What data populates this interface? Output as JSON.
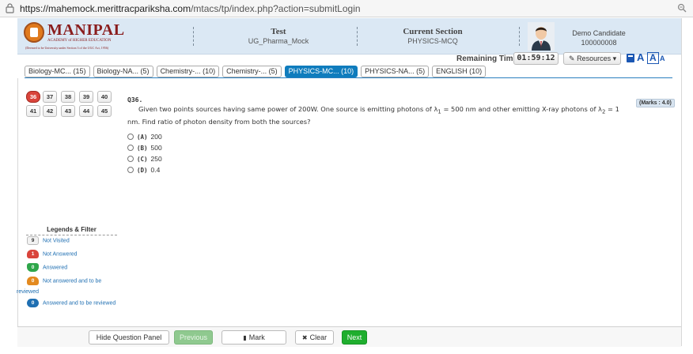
{
  "browser": {
    "url_host": "https://mahemock.merittracpariksha.com",
    "url_path": "/mtacs/tp/index.php?action=submitLogin",
    "lock_icon": "lock-icon",
    "zoom_icon": "zoom-icon"
  },
  "header": {
    "logo_name": "MANIPAL",
    "logo_sub1": "ACADEMY of HIGHER EDUCATION",
    "logo_sub2": "(Deemed to be University under Section 3 of the UGC Act, 1956)",
    "test_label": "Test",
    "test_value": "UG_Pharma_Mock",
    "section_label": "Current Section",
    "section_value": "PHYSICS-MCQ",
    "candidate_name": "Demo Candidate",
    "candidate_id": "100000008"
  },
  "timer": {
    "label": "Remaining Time:",
    "value": "01:59:12"
  },
  "toolbar": {
    "resources_label": "Resources",
    "font_large": "A",
    "font_medium": "A",
    "font_small": "A"
  },
  "tabs": [
    {
      "label": "Biology-MC... (15)",
      "active": false
    },
    {
      "label": "Biology-NA... (5)",
      "active": false
    },
    {
      "label": "Chemistry-... (10)",
      "active": false
    },
    {
      "label": "Chemistry-... (5)",
      "active": false
    },
    {
      "label": "PHYSICS-MC... (10)",
      "active": true
    },
    {
      "label": "PHYSICS-NA... (5)",
      "active": false
    },
    {
      "label": "ENGLISH (10)",
      "active": false
    }
  ],
  "palette": {
    "row1": [
      "36",
      "37",
      "38",
      "39",
      "40"
    ],
    "row2": [
      "41",
      "42",
      "43",
      "44",
      "45"
    ],
    "current": "36"
  },
  "question": {
    "number": "Q36.",
    "marks": "(Marks : 4.0)",
    "text_a": "Given two points sources having same power of 200W. One source is emitting photons of λ",
    "sub1": "1",
    "text_b": " = 500 nm and other emitting X-ray photons of λ",
    "sub2": "2",
    "text_c": " = 1 nm. Find ratio of photon density from both the sources?",
    "options": [
      {
        "label": "(A)",
        "value": "200"
      },
      {
        "label": "(B)",
        "value": "500"
      },
      {
        "label": "(C)",
        "value": "250"
      },
      {
        "label": "(D)",
        "value": "0.4"
      }
    ]
  },
  "legend": {
    "title": "Legends & Filter",
    "items": [
      {
        "count": "9",
        "label": "Not Visited"
      },
      {
        "count": "1",
        "label": "Not Answered"
      },
      {
        "count": "0",
        "label": "Answered"
      },
      {
        "count": "0",
        "label": "Not answered and to be"
      },
      {
        "count": "0",
        "label": "Answered and to be reviewed"
      }
    ],
    "wrap_text": "reviewed"
  },
  "footer": {
    "hide_panel": "Hide Question Panel",
    "previous": "Previous",
    "mark": "Mark",
    "clear": "Clear",
    "next": "Next"
  },
  "colors": {
    "header_bg": "#dbe8f4",
    "active_tab": "#0f7cbd",
    "not_answered": "#d9443b",
    "answered": "#2ea64a",
    "marked": "#e38a1f",
    "reviewed": "#1f6fb2",
    "next_button": "#1fae2e"
  }
}
